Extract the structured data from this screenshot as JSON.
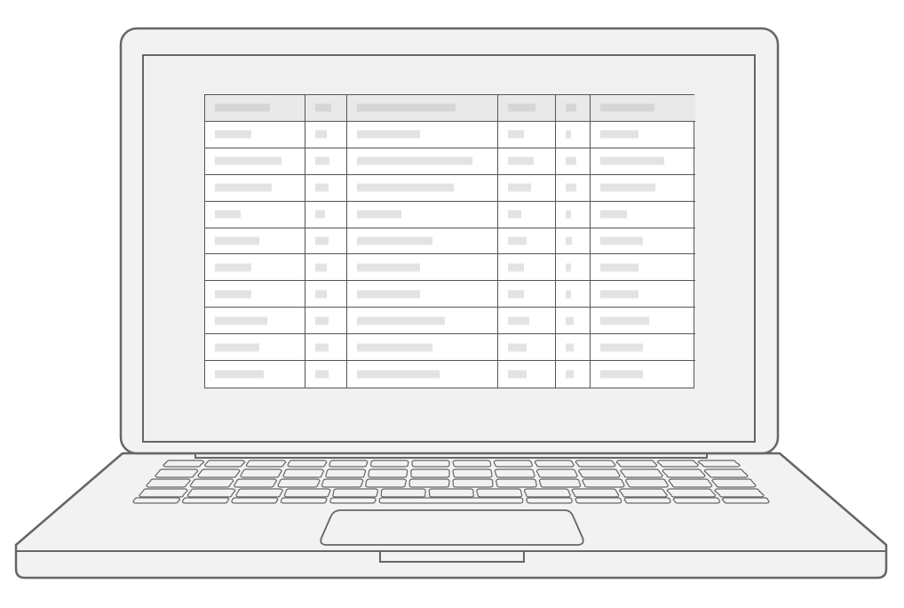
{
  "illustration": {
    "subject": "laptop",
    "screen_content": "placeholder-table",
    "colors": {
      "outline": "#666666",
      "body_fill": "#f2f2f2",
      "screen_fill": "#f0f0f0",
      "table_border": "#555555",
      "header_fill": "#e9e9e9",
      "placeholder_bar": "#e3e3e3"
    },
    "table": {
      "columns": 6,
      "rows": 11,
      "header_rows": 1,
      "placeholder_fill_fraction": [
        [
          0.64,
          0.55,
          0.72,
          0.63,
          0.45,
          0.59
        ],
        [
          0.41,
          0.36,
          0.45,
          0.33,
          0.12,
          0.41
        ],
        [
          0.78,
          0.48,
          0.85,
          0.57,
          0.45,
          0.71
        ],
        [
          0.66,
          0.45,
          0.71,
          0.5,
          0.45,
          0.6
        ],
        [
          0.28,
          0.27,
          0.31,
          0.25,
          0.12,
          0.27
        ],
        [
          0.51,
          0.45,
          0.55,
          0.4,
          0.2,
          0.46
        ],
        [
          0.41,
          0.36,
          0.45,
          0.33,
          0.12,
          0.41
        ],
        [
          0.41,
          0.36,
          0.45,
          0.33,
          0.12,
          0.41
        ],
        [
          0.6,
          0.45,
          0.64,
          0.46,
          0.31,
          0.53
        ],
        [
          0.51,
          0.45,
          0.55,
          0.4,
          0.31,
          0.46
        ],
        [
          0.56,
          0.45,
          0.6,
          0.4,
          0.31,
          0.46
        ]
      ]
    }
  }
}
